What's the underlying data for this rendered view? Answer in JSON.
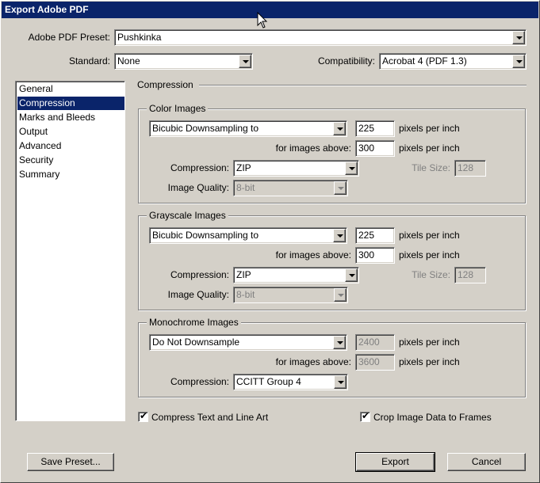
{
  "window": {
    "title": "Export Adobe PDF"
  },
  "preset": {
    "label": "Adobe PDF Preset:",
    "value": "Pushkinka"
  },
  "standard": {
    "label": "Standard:",
    "value": "None"
  },
  "compatibility": {
    "label": "Compatibility:",
    "value": "Acrobat 4 (PDF 1.3)"
  },
  "sidebar": {
    "items": [
      {
        "label": "General"
      },
      {
        "label": "Compression"
      },
      {
        "label": "Marks and Bleeds"
      },
      {
        "label": "Output"
      },
      {
        "label": "Advanced"
      },
      {
        "label": "Security"
      },
      {
        "label": "Summary"
      }
    ]
  },
  "panel": {
    "title": "Compression"
  },
  "color": {
    "title": "Color Images",
    "downsample": "Bicubic Downsampling to",
    "ppi": "225",
    "ppi_unit": "pixels per inch",
    "above_label": "for images above:",
    "above": "300",
    "above_unit": "pixels per inch",
    "compression_label": "Compression:",
    "compression": "ZIP",
    "tile_label": "Tile Size:",
    "tile": "128",
    "quality_label": "Image Quality:",
    "quality": "8-bit"
  },
  "gray": {
    "title": "Grayscale Images",
    "downsample": "Bicubic Downsampling to",
    "ppi": "225",
    "ppi_unit": "pixels per inch",
    "above_label": "for images above:",
    "above": "300",
    "above_unit": "pixels per inch",
    "compression_label": "Compression:",
    "compression": "ZIP",
    "tile_label": "Tile Size:",
    "tile": "128",
    "quality_label": "Image Quality:",
    "quality": "8-bit"
  },
  "mono": {
    "title": "Monochrome Images",
    "downsample": "Do Not Downsample",
    "ppi": "2400",
    "ppi_unit": "pixels per inch",
    "above_label": "for images above:",
    "above": "3600",
    "above_unit": "pixels per inch",
    "compression_label": "Compression:",
    "compression": "CCITT Group 4"
  },
  "options": {
    "compress_text": {
      "label": "Compress Text and Line Art",
      "checked": true
    },
    "crop_image": {
      "label": "Crop Image Data to Frames",
      "checked": true
    },
    "check_mark": "✔"
  },
  "buttons": {
    "save_preset": "Save Preset...",
    "export": "Export",
    "cancel": "Cancel"
  }
}
